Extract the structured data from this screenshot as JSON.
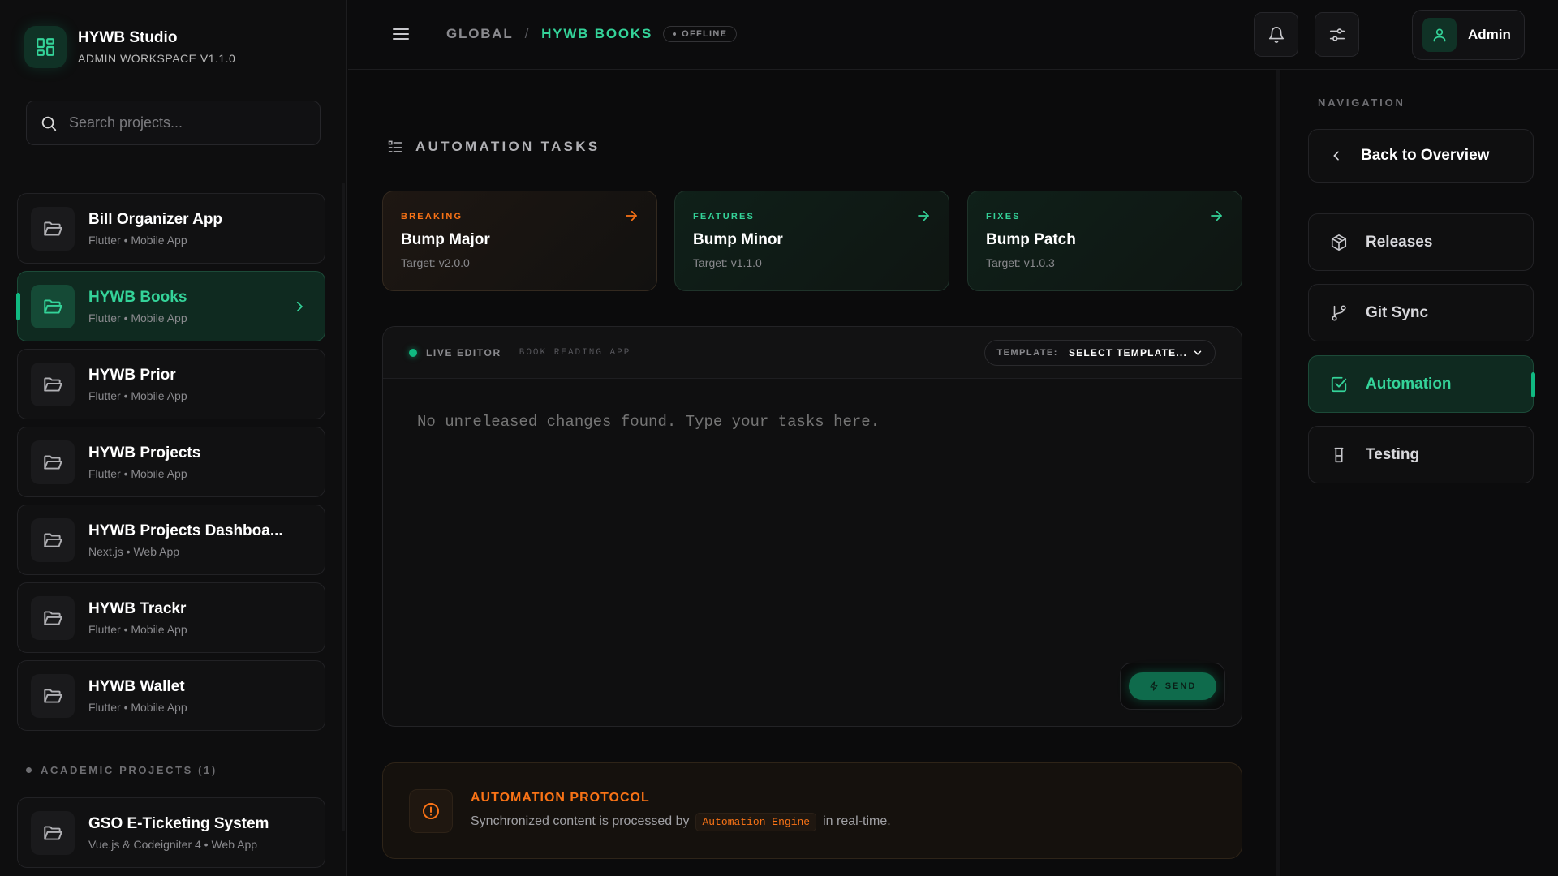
{
  "brand": {
    "title": "HYWB Studio",
    "subtitle": "ADMIN WORKSPACE V1.1.0"
  },
  "search": {
    "placeholder": "Search projects...",
    "value": ""
  },
  "projects": [
    {
      "name": "Bill Organizer App",
      "meta": "Flutter • Mobile App",
      "active": false
    },
    {
      "name": "HYWB Books",
      "meta": "Flutter • Mobile App",
      "active": true
    },
    {
      "name": "HYWB Prior",
      "meta": "Flutter • Mobile App",
      "active": false
    },
    {
      "name": "HYWB Projects",
      "meta": "Flutter • Mobile App",
      "active": false
    },
    {
      "name": "HYWB Projects Dashboa...",
      "meta": "Next.js • Web App",
      "active": false
    },
    {
      "name": "HYWB Trackr",
      "meta": "Flutter • Mobile App",
      "active": false
    },
    {
      "name": "HYWB Wallet",
      "meta": "Flutter • Mobile App",
      "active": false
    }
  ],
  "academic": {
    "label": "ACADEMIC PROJECTS (1)",
    "projects": [
      {
        "name": "GSO E-Ticketing System",
        "meta": "Vue.js & Codeigniter 4 • Web App"
      }
    ]
  },
  "header": {
    "breadcrumb": {
      "root": "GLOBAL",
      "separator": "/",
      "current": "HYWB BOOKS"
    },
    "status": "OFFLINE",
    "user": {
      "name": "Admin"
    }
  },
  "tasks": {
    "heading": "AUTOMATION TASKS",
    "cards": [
      {
        "tag": "BREAKING",
        "title": "Bump Major",
        "target": "Target: v2.0.0"
      },
      {
        "tag": "FEATURES",
        "title": "Bump Minor",
        "target": "Target: v1.1.0"
      },
      {
        "tag": "FIXES",
        "title": "Bump Patch",
        "target": "Target: v1.0.3"
      }
    ]
  },
  "editor": {
    "live_label": "LIVE EDITOR",
    "context": "BOOK READING APP",
    "template_label": "TEMPLATE:",
    "template_value": "SELECT TEMPLATE...",
    "placeholder": "No unreleased changes found. Type your tasks here.",
    "send_label": "SEND"
  },
  "protocol": {
    "title": "AUTOMATION PROTOCOL",
    "desc_before": "Synchronized content is processed by",
    "code": "Automation Engine",
    "desc_after": "in real-time."
  },
  "nav": {
    "title": "NAVIGATION",
    "back": "Back to Overview",
    "items": [
      {
        "label": "Releases",
        "icon": "box-icon"
      },
      {
        "label": "Git Sync",
        "icon": "git-branch-icon"
      },
      {
        "label": "Automation",
        "icon": "checkbox-icon",
        "active": true
      },
      {
        "label": "Testing",
        "icon": "flask-icon"
      }
    ]
  },
  "colors": {
    "accent": "#10b981",
    "accent_text": "#34d399",
    "warning": "#f97316",
    "background": "#0b0b0c"
  }
}
